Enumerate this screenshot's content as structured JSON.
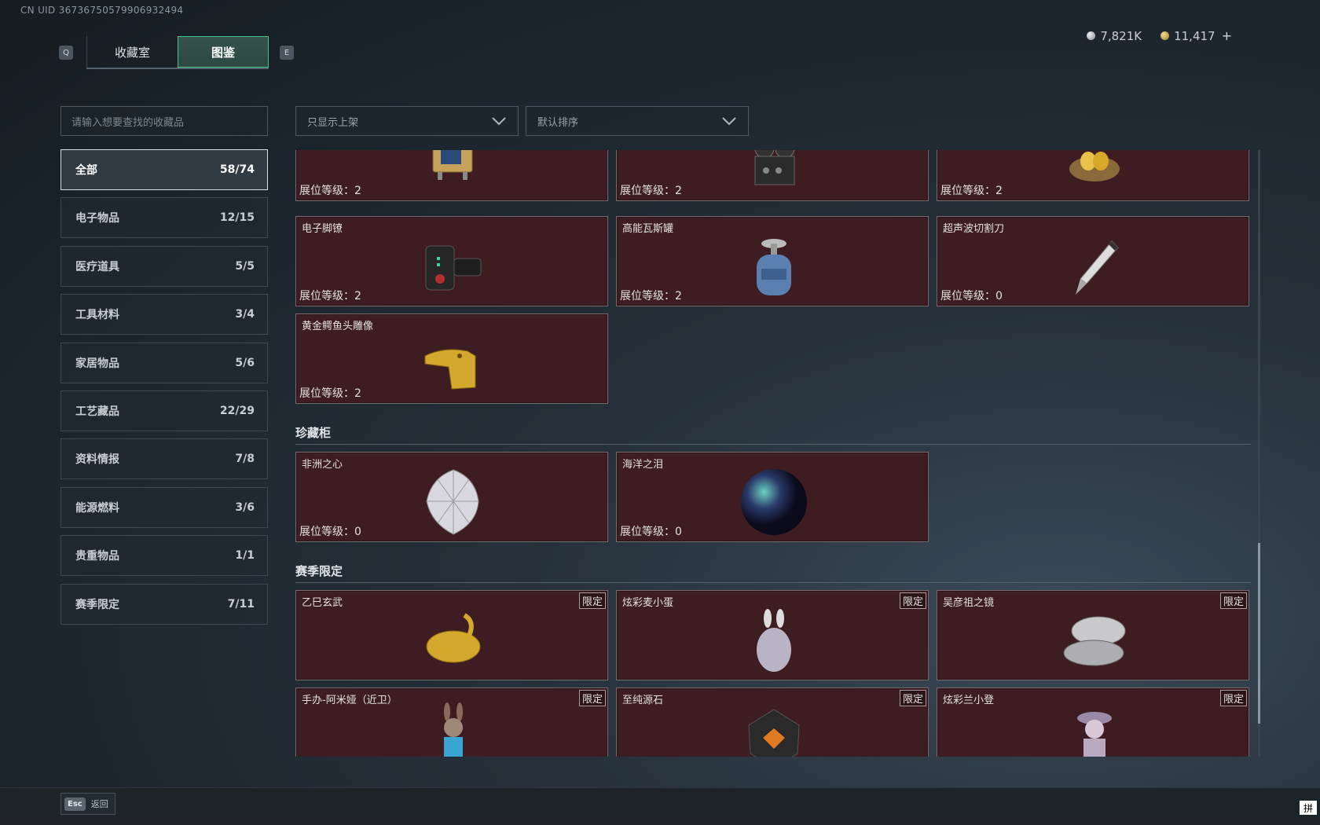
{
  "header": {
    "uid": "CN UID 3673675057990693​2494",
    "tabs": [
      "收藏室",
      "图鉴"
    ],
    "left_key": "Q",
    "right_key": "E",
    "currency": {
      "silver": "7,821K",
      "gold": "11,417"
    },
    "plus_icon": "+"
  },
  "search": {
    "placeholder": "请输入想要查找的收藏品"
  },
  "filters": {
    "display": "只显示上架",
    "sort": "默认排序"
  },
  "categories": [
    {
      "label": "全部",
      "count": "58/74"
    },
    {
      "label": "电子物品",
      "count": "12/15"
    },
    {
      "label": "医疗道具",
      "count": "5/5"
    },
    {
      "label": "工具材料",
      "count": "3/4"
    },
    {
      "label": "家居物品",
      "count": "5/6"
    },
    {
      "label": "工艺藏品",
      "count": "22/29"
    },
    {
      "label": "资料情报",
      "count": "7/8"
    },
    {
      "label": "能源燃料",
      "count": "3/6"
    },
    {
      "label": "贵重物品",
      "count": "1/1"
    },
    {
      "label": "赛季限定",
      "count": "7/11"
    }
  ],
  "level_prefix": "展位等级：",
  "limited_tag": "限定",
  "items_top_row": [
    {
      "name": "",
      "level": "2",
      "icon": "device-icon"
    },
    {
      "name": "",
      "level": "2",
      "icon": "tape-recorder-icon"
    },
    {
      "name": "",
      "level": "2",
      "icon": "golden-eggs-nest-icon"
    }
  ],
  "items_row2": [
    {
      "name": "电子脚镣",
      "level": "2",
      "icon": "ankle-monitor-icon"
    },
    {
      "name": "高能瓦斯罐",
      "level": "2",
      "icon": "gas-canister-icon"
    },
    {
      "name": "超声波切割刀",
      "level": "0",
      "icon": "knife-icon"
    }
  ],
  "items_row3": [
    {
      "name": "黄金鳄鱼头雕像",
      "level": "2",
      "icon": "gold-croc-statue-icon"
    }
  ],
  "section_treasure": {
    "title": "珍藏柜",
    "items": [
      {
        "name": "非洲之心",
        "level": "0",
        "icon": "diamond-icon"
      },
      {
        "name": "海洋之泪",
        "level": "0",
        "icon": "orb-icon"
      }
    ]
  },
  "section_season": {
    "title": "赛季限定",
    "items": [
      {
        "name": "乙巳玄武",
        "icon": "gold-dragon-icon"
      },
      {
        "name": "炫彩麦小蛋",
        "icon": "bunny-egg-icon"
      },
      {
        "name": "吴彦祖之镜",
        "icon": "compact-mirror-icon"
      },
      {
        "name": "手办-阿米娅（近卫）",
        "icon": "figure-icon"
      },
      {
        "name": "至纯源石",
        "icon": "crystal-icon"
      },
      {
        "name": "炫彩兰小登",
        "icon": "figure2-icon"
      }
    ]
  },
  "footer": {
    "esc_key": "Esc",
    "back_label": "返回",
    "ime": "拼"
  }
}
